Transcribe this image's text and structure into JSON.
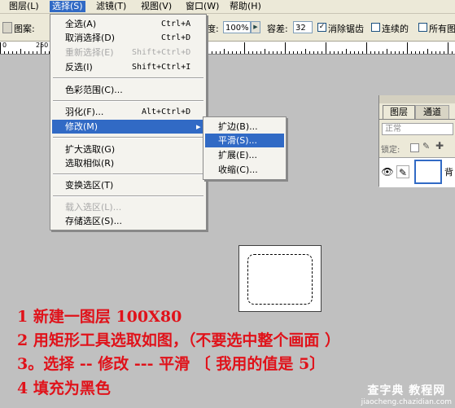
{
  "menubar": {
    "items": [
      "图层(L)",
      "选择(S)",
      "滤镜(T)",
      "视图(V)",
      "窗口(W)",
      "帮助(H)"
    ]
  },
  "options": {
    "pattern_label": "图案:",
    "opacity_label": "度:",
    "opacity_value": "100%",
    "tolerance_label": "容差:",
    "tolerance_value": "32",
    "antialias_label": "消除锯齿",
    "antialias_checked": true,
    "contiguous_label": "连续的",
    "contiguous_checked": false,
    "all_layers_label": "所有图",
    "all_layers_checked": false
  },
  "ruler": {
    "labels": [
      "0",
      "250"
    ]
  },
  "select_menu": {
    "items": [
      {
        "label": "全选(A)",
        "shortcut": "Ctrl+A"
      },
      {
        "label": "取消选择(D)",
        "shortcut": "Ctrl+D"
      },
      {
        "label": "重新选择(E)",
        "shortcut": "Shift+Ctrl+D"
      },
      {
        "label": "反选(I)",
        "shortcut": "Shift+Ctrl+I"
      },
      {
        "label": "色彩范围(C)..."
      },
      {
        "label": "羽化(F)...",
        "shortcut": "Alt+Ctrl+D"
      },
      {
        "label": "修改(M)"
      },
      {
        "label": "扩大选取(G)"
      },
      {
        "label": "选取相似(R)"
      },
      {
        "label": "变换选区(T)"
      },
      {
        "label": "载入选区(L)..."
      },
      {
        "label": "存储选区(S)..."
      }
    ]
  },
  "modify_submenu": {
    "items": [
      "扩边(B)...",
      "平滑(S)...",
      "扩展(E)...",
      "收缩(C)..."
    ]
  },
  "layers_panel": {
    "tabs": [
      "图层",
      "通道"
    ],
    "blend_mode": "正常",
    "lock_label": "锁定:",
    "layer_name": "背"
  },
  "steps": [
    "1 新建一图层 100X80",
    "2 用矩形工具选取如图，（不要选中整个画面 ）",
    "3。选择 -- 修改 --- 平滑 〔 我用的值是 5〕",
    "4 填充为黑色"
  ],
  "watermark": {
    "title": "查字典 教程网",
    "url": "jiaocheng.chazidian.com"
  },
  "colors": {
    "highlight": "#316ac5",
    "step_text": "#e0121a"
  }
}
